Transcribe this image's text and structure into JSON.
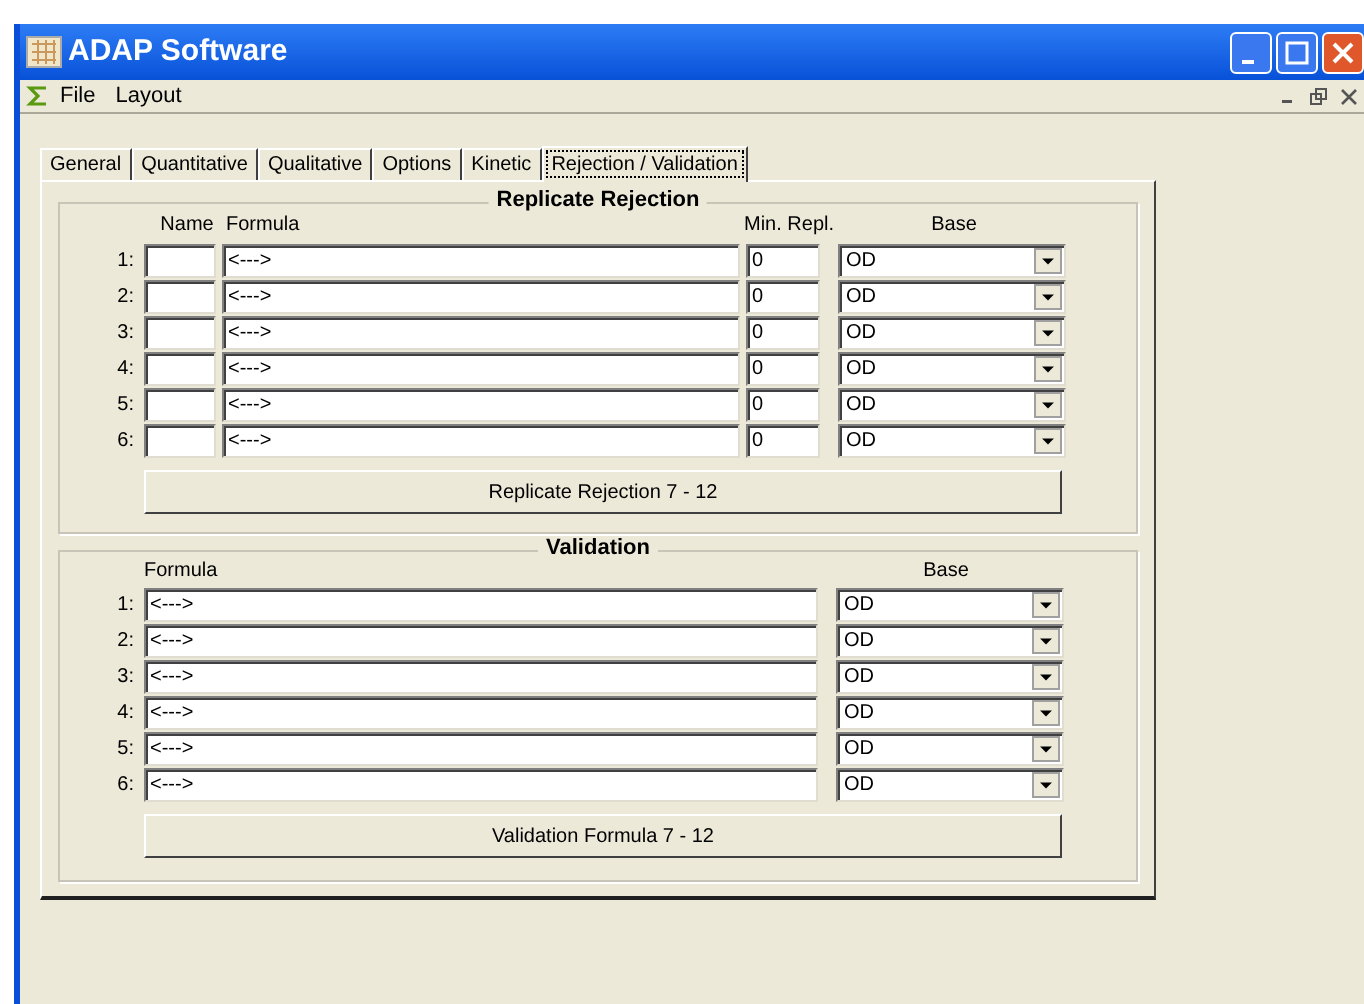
{
  "window": {
    "title": "ADAP Software"
  },
  "menu": [
    "File",
    "Layout"
  ],
  "tabs": [
    {
      "label": "General",
      "selected": false
    },
    {
      "label": "Quantitative",
      "selected": false
    },
    {
      "label": "Qualitative",
      "selected": false
    },
    {
      "label": "Options",
      "selected": false
    },
    {
      "label": "Kinetic",
      "selected": false
    },
    {
      "label": "Rejection / Validation",
      "selected": true
    }
  ],
  "replicate_rejection": {
    "title": "Replicate Rejection",
    "columns": [
      "Name",
      "Formula",
      "Min. Repl.",
      "Base"
    ],
    "rows": [
      {
        "index": "1:",
        "formula": "<--->",
        "min_repl": "0",
        "base": "OD"
      },
      {
        "index": "2:",
        "formula": "<--->",
        "min_repl": "0",
        "base": "OD"
      },
      {
        "index": "3:",
        "formula": "<--->",
        "min_repl": "0",
        "base": "OD"
      },
      {
        "index": "4:",
        "formula": "<--->",
        "min_repl": "0",
        "base": "OD"
      },
      {
        "index": "5:",
        "formula": "<--->",
        "min_repl": "0",
        "base": "OD"
      },
      {
        "index": "6:",
        "formula": "<--->",
        "min_repl": "0",
        "base": "OD"
      }
    ],
    "button": "Replicate Rejection 7 - 12"
  },
  "validation": {
    "title": "Validation",
    "columns": [
      "Formula",
      "Base"
    ],
    "rows": [
      {
        "index": "1:",
        "formula": "<--->",
        "base": "OD"
      },
      {
        "index": "2:",
        "formula": "<--->",
        "base": "OD"
      },
      {
        "index": "3:",
        "formula": "<--->",
        "base": "OD"
      },
      {
        "index": "4:",
        "formula": "<--->",
        "base": "OD"
      },
      {
        "index": "5:",
        "formula": "<--->",
        "base": "OD"
      },
      {
        "index": "6:",
        "formula": "<--->",
        "base": "OD"
      }
    ],
    "button": "Validation Formula 7 - 12"
  }
}
